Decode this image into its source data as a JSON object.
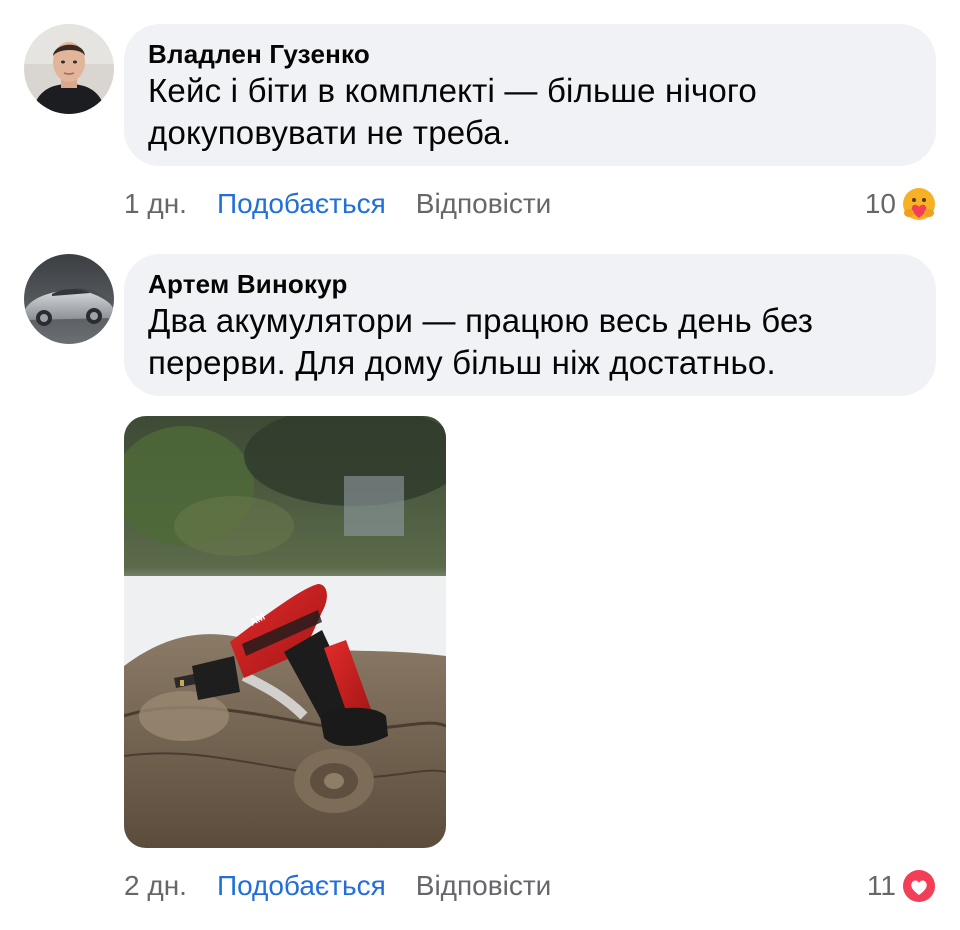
{
  "comments": [
    {
      "author": "Владлен Гузенко",
      "text_line1": "Кейс і біти в комплекті — більше нічого",
      "text_line2": "докуповувати не треба.",
      "time": "1 дн.",
      "like_label": "Подобається",
      "reply_label": "Відповісти",
      "reaction_count": "10",
      "reaction_icon": "care-hug-emoji-icon"
    },
    {
      "author": "Артем Винокур",
      "text_line1": "Два акумулятори — працюю весь день без",
      "text_line2": "перерви. Для дому більш ніж достатньо.",
      "time": "2 дн.",
      "like_label": "Подобається",
      "reply_label": "Відповісти",
      "reaction_count": "11",
      "reaction_icon": "heart-love-icon"
    }
  ],
  "colors": {
    "bubble": "#f0f2f5",
    "like_link": "#216fdb",
    "meta_text": "#65676b",
    "love_reaction": "#f33e58",
    "care_reaction": "#f7b125"
  }
}
